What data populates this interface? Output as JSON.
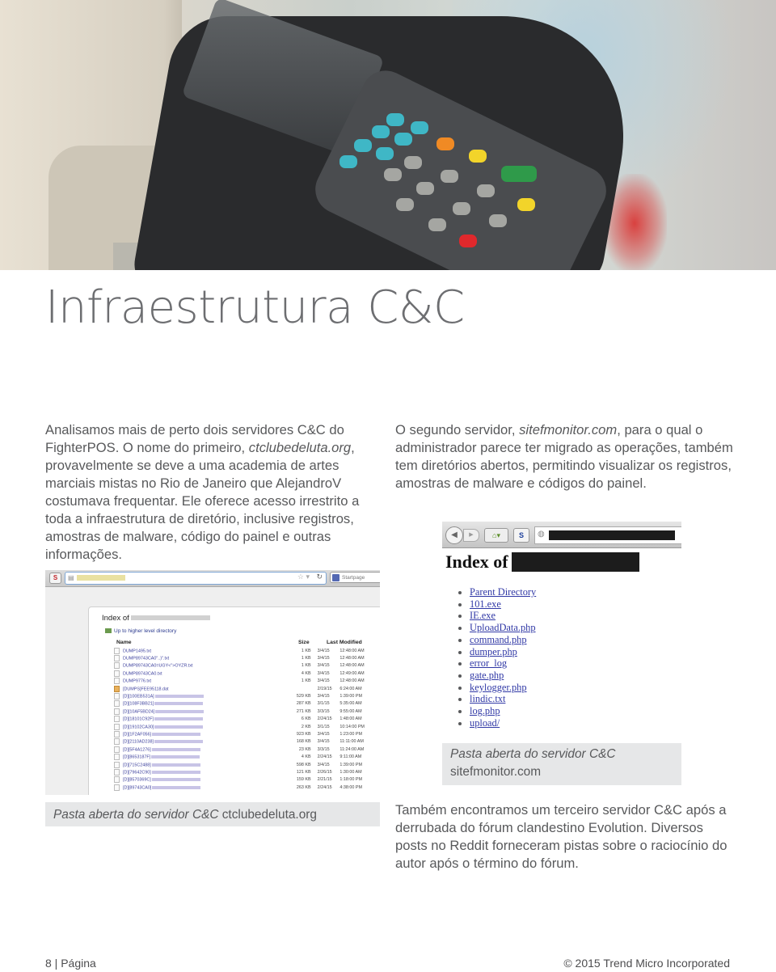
{
  "hero": {
    "image_description": "Close-up of a point-of-sale card payment terminal keypad",
    "icon": "pos-terminal-photo"
  },
  "title": "Infraestrutura C&C",
  "paragraph_left": {
    "before": "Analisamos mais de perto dois servidores C&C do FighterPOS. O nome do primeiro, ",
    "emphasis": "ctclubedeluta.org",
    "after": ", provavelmente se deve a uma academia de artes marciais mistas no Rio de Janeiro que AlejandroV costumava frequentar. Ele oferece acesso irrestrito a toda a infraestrutura de diretório, inclusive registros, amostras de malware, código do painel e outras informações."
  },
  "paragraph_right": {
    "before": "O segundo servidor, ",
    "emphasis": "sitefmonitor.com",
    "after": ", para o qual o administrador parece ter migrado as operações, também tem diretórios abertos, permitindo visualizar os registros, amostras de malware e códigos do painel."
  },
  "paragraph_bottom": "Também encontramos um terceiro servidor C&C após a derrubada do fórum clandestino Evolution. Diversos posts no Reddit forneceram pistas sobre o raciocínio do autor após o término do fórum.",
  "screenshot_left": {
    "search_engine_label": "Startpage",
    "index_label": "Index of",
    "up_link": "Up to higher level directory",
    "columns": {
      "name": "Name",
      "size": "Size",
      "modified": "Last Modified"
    },
    "rows": [
      {
        "name": "DUMP1495.txt",
        "blur": false,
        "icon": "file",
        "size": "1 KB",
        "date": "3/4/15",
        "time": "12:48:00 AM"
      },
      {
        "name": "DUMP89743CA0\"..)\".txt",
        "blur": false,
        "icon": "file",
        "size": "1 KB",
        "date": "3/4/15",
        "time": "12:48:00 AM"
      },
      {
        "name": "DUMP89743CA0=UGY<\">OYZR.txt",
        "blur": false,
        "icon": "file",
        "size": "1 KB",
        "date": "3/4/15",
        "time": "12:48:00 AM"
      },
      {
        "name": "DUMP89743CA0.txt",
        "blur": false,
        "icon": "file",
        "size": "4 KB",
        "date": "3/4/15",
        "time": "12:49:00 AM"
      },
      {
        "name": "DUMP9776.txt",
        "blur": false,
        "icon": "file",
        "size": "1 KB",
        "date": "3/4/15",
        "time": "12:48:00 AM"
      },
      {
        "name": "[DUMPS]FEE95118.dat",
        "blur": false,
        "icon": "archive",
        "size": "",
        "date": "2/19/15",
        "time": "6:24:00 AM"
      },
      {
        "name": "[D][100EB531A]",
        "blur": true,
        "icon": "file",
        "size": "529 KB",
        "date": "3/4/15",
        "time": "1:39:00 PM"
      },
      {
        "name": "[D][108F3BB21]",
        "blur": true,
        "icon": "file",
        "size": "287 KB",
        "date": "3/1/15",
        "time": "5:35:00 AM"
      },
      {
        "name": "[D][10AF5BD24]",
        "blur": true,
        "icon": "file",
        "size": "271 KB",
        "date": "3/3/15",
        "time": "9:55:00 AM"
      },
      {
        "name": "[D][18101C92F]",
        "blur": true,
        "icon": "file",
        "size": "6 KB",
        "date": "2/24/15",
        "time": "1:48:00 AM"
      },
      {
        "name": "[D][19102CA30]",
        "blur": true,
        "icon": "file",
        "size": "2 KB",
        "date": "3/1/15",
        "time": "10:14:00 PM"
      },
      {
        "name": "[D][1F2AF056]",
        "blur": true,
        "icon": "file",
        "size": "923 KB",
        "date": "3/4/15",
        "time": "1:23:00 PM"
      },
      {
        "name": "[D][2110AD238]",
        "blur": true,
        "icon": "file",
        "size": "168 KB",
        "date": "3/4/15",
        "time": "11:11:00 AM"
      },
      {
        "name": "[D][5F4A1276]",
        "blur": true,
        "icon": "file",
        "size": "23 KB",
        "date": "3/3/15",
        "time": "11:24:00 AM"
      },
      {
        "name": "[D][8653187F]",
        "blur": true,
        "icon": "file",
        "size": "4 KB",
        "date": "2/24/15",
        "time": "9:11:00 AM"
      },
      {
        "name": "[D][715C2488]",
        "blur": true,
        "icon": "file",
        "size": "598 KB",
        "date": "3/4/15",
        "time": "1:39:00 PM"
      },
      {
        "name": "[D][79642C90]",
        "blur": true,
        "icon": "file",
        "size": "121 KB",
        "date": "2/26/15",
        "time": "1:30:00 AM"
      },
      {
        "name": "[D][8570369C]",
        "blur": true,
        "icon": "file",
        "size": "159 KB",
        "date": "2/21/15",
        "time": "1:18:00 PM"
      },
      {
        "name": "[D][89743CA0]",
        "blur": true,
        "icon": "file",
        "size": "263 KB",
        "date": "2/24/15",
        "time": "4:38:00 PM"
      }
    ]
  },
  "caption_left": {
    "emphasis": "Pasta aberta do servidor C&C",
    "rest": " ctclubedeluta.org"
  },
  "screenshot_right": {
    "index_label": "Index of",
    "links": [
      "Parent Directory",
      "101.exe",
      "IE.exe",
      "UploadData.php",
      "command.php",
      "dumper.php",
      "error_log",
      "gate.php",
      "keylogger.php",
      "lindic.txt",
      "log.php",
      "upload/"
    ]
  },
  "caption_right": {
    "emphasis": "Pasta aberta do servidor C&C",
    "rest": "sitefmonitor.com"
  },
  "footer": {
    "page": "8 | Página",
    "copyright": "© 2015 Trend Micro Incorporated"
  }
}
